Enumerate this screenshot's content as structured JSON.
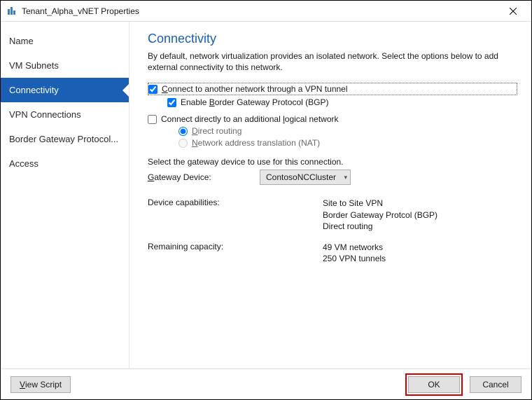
{
  "window": {
    "title": "Tenant_Alpha_vNET Properties"
  },
  "sidebar": {
    "items": [
      {
        "label": "Name"
      },
      {
        "label": "VM Subnets"
      },
      {
        "label": "Connectivity"
      },
      {
        "label": "VPN Connections"
      },
      {
        "label": "Border Gateway Protocol..."
      },
      {
        "label": "Access"
      }
    ]
  },
  "page": {
    "title": "Connectivity",
    "intro": "By default, network virtualization provides an isolated network. Select the options below to add external connectivity to this network.",
    "vpn_checkbox_pre": "C",
    "vpn_checkbox_post": "onnect to another network through a VPN tunnel",
    "bgp_checkbox_pre": "Enable ",
    "bgp_checkbox_u": "B",
    "bgp_checkbox_post": "order Gateway Protocol (BGP)",
    "direct_checkbox_pre": "Connect directly to an additional ",
    "direct_checkbox_u": "l",
    "direct_checkbox_post": "ogical network",
    "routing_direct_u": "D",
    "routing_direct_post": "irect routing",
    "routing_nat_u": "N",
    "routing_nat_post": "etwork address translation (NAT)",
    "gateway_prompt": "Select the gateway device to use for this connection.",
    "gateway_label_u": "G",
    "gateway_label_post": "ateway Device:",
    "gateway_value": "ContosoNCCluster",
    "caps_label": "Device capabilities:",
    "caps_values": [
      "Site to Site VPN",
      "Border Gateway Protcol (BGP)",
      "Direct routing"
    ],
    "remaining_label": "Remaining capacity:",
    "remaining_values": [
      "49 VM networks",
      "250 VPN tunnels"
    ]
  },
  "footer": {
    "view_script_u": "V",
    "view_script_post": "iew Script",
    "ok": "OK",
    "cancel": "Cancel"
  }
}
